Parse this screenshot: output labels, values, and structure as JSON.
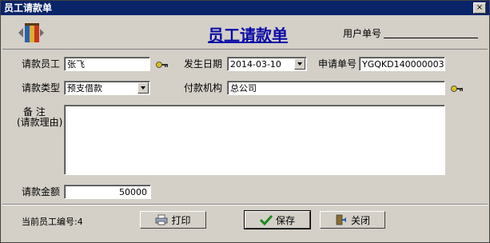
{
  "window": {
    "title": "员工请款单",
    "close_glyph": "×"
  },
  "header": {
    "form_title": "员工请款单",
    "user_no_label": "用户单号"
  },
  "form": {
    "employee_label": "请款员工",
    "employee_value": "张飞",
    "date_label": "发生日期",
    "date_value": "2014-03-10",
    "request_no_label": "申请单号",
    "request_no_value": "YGQKD140000003",
    "type_label": "请款类型",
    "type_value": "预支借款",
    "payer_label": "付款机构",
    "payer_value": "总公司",
    "remark_label_line1": "备    注",
    "remark_label_line2": "(请款理由)",
    "remark_value": "",
    "amount_label": "请款金额",
    "amount_value": "50000"
  },
  "footer": {
    "current_employee_label": "当前员工编号:4",
    "print_label": "打印",
    "save_label": "保存",
    "close_label": "关闭"
  },
  "icons": {
    "logo": "book-logo-icon",
    "lookup": "key-lookup-icon",
    "print": "printer-icon",
    "save": "checkmark-icon",
    "close": "exit-door-icon"
  }
}
